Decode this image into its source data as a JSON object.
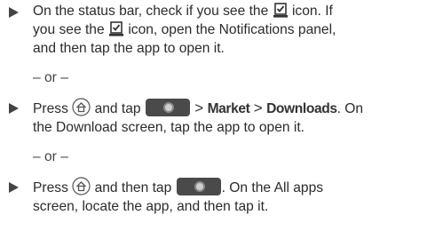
{
  "step1": {
    "line1_a": "On the status bar, check if you see the",
    "line1_b": "icon. If",
    "line2_a": "you see the",
    "line2_b": "icon, open the Notifications panel,",
    "line3": "and then tap the app to open it.",
    "icon": "download-complete-icon"
  },
  "or1": "– or –",
  "step2": {
    "press": "Press",
    "and_tap": "and tap",
    "sep": ">",
    "market": "Market",
    "downloads": "Downloads",
    "line1_end": ". On",
    "line2": "the Download screen, tap the app to open it.",
    "home_icon": "home-button-icon",
    "apps_icon": "all-apps-button-icon"
  },
  "or2": "– or –",
  "step3": {
    "press": "Press",
    "and_then_tap": "and then tap",
    "line1_end": ". On the All apps",
    "line2": "screen, locate the app, and then tap it."
  }
}
